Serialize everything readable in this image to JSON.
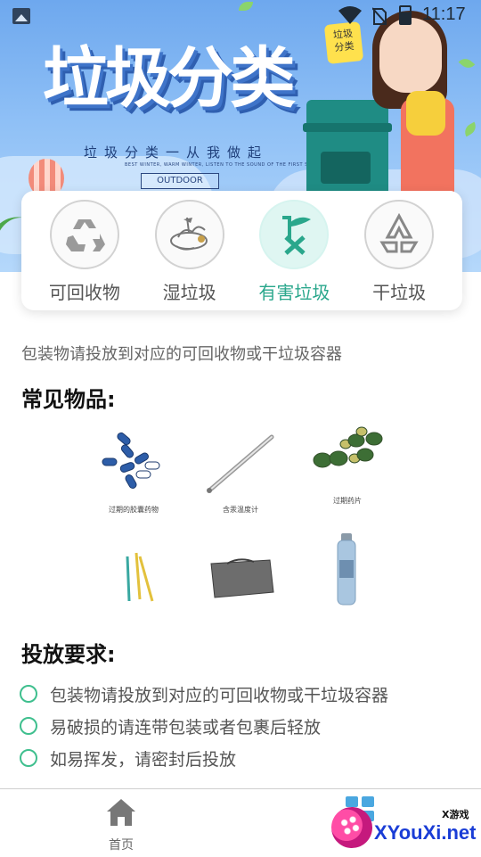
{
  "status_bar": {
    "time": "11:17",
    "icons": [
      "gallery-icon",
      "wifi-icon",
      "no-sim-icon",
      "battery-icon"
    ]
  },
  "banner": {
    "title": "垃圾分类",
    "tag_line1": "垃圾",
    "tag_line2": "分类",
    "subtitle": "垃圾分类一从我做起",
    "small_text": "BEST WINTER, WARM WINTER, LISTEN TO THE SOUND OF THE FIRST SNOW",
    "badge": "OUTDOOR TRAVEL"
  },
  "categories": [
    {
      "label": "可回收物",
      "icon": "recycle-icon",
      "active": false
    },
    {
      "label": "湿垃圾",
      "icon": "wet-waste-icon",
      "active": false
    },
    {
      "label": "有害垃圾",
      "icon": "hazardous-waste-icon",
      "active": true
    },
    {
      "label": "干垃圾",
      "icon": "dry-waste-icon",
      "active": false
    }
  ],
  "tip": "包装物请投放到对应的可回收物或干垃圾容器",
  "items_section": {
    "title": "常见物品:",
    "items": [
      {
        "caption": "过期的胶囊药物",
        "icon": "capsules-icon"
      },
      {
        "caption": "含汞温度计",
        "icon": "thermometer-icon"
      },
      {
        "caption": "过期药片",
        "icon": "pills-icon"
      },
      {
        "caption": "",
        "icon": "battery-sticks-icon"
      },
      {
        "caption": "",
        "icon": "bag-icon"
      },
      {
        "caption": "",
        "icon": "spray-can-icon"
      }
    ]
  },
  "rules_section": {
    "title": "投放要求:",
    "rules": [
      "包装物请投放到对应的可回收物或干垃圾容器",
      "易破损的请连带包装或者包裹后轻放",
      "如易挥发，请密封后投放"
    ]
  },
  "bottom_nav": {
    "home_label": "首页",
    "home_icon": "home-icon",
    "second_icon": "grid-icon"
  },
  "watermark": {
    "small": "X游戏",
    "big": "XYouXi.net"
  },
  "colors": {
    "accent": "#2aa78c",
    "active_circle_bg": "#dff6f2",
    "radio_border": "#3fbf8e"
  }
}
